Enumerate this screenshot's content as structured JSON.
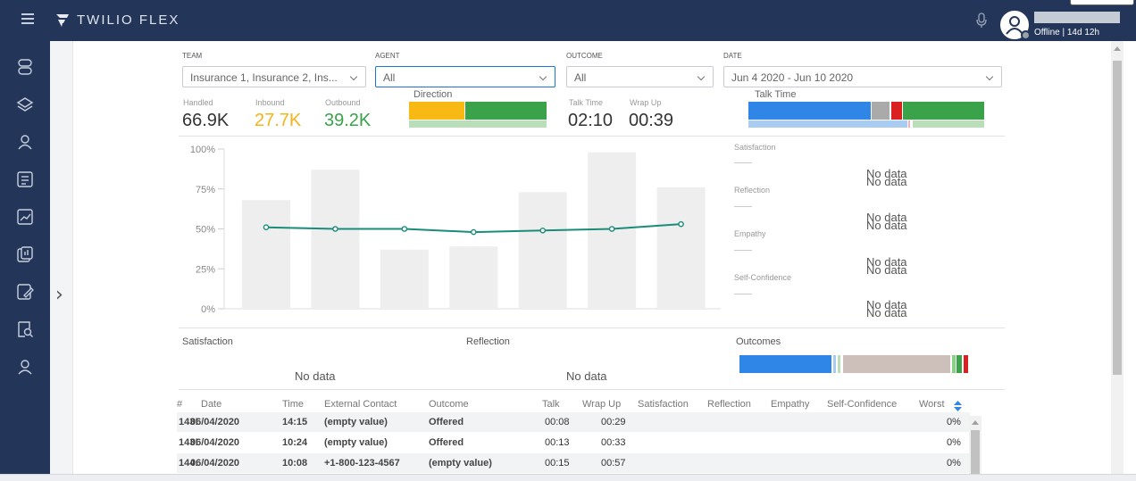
{
  "header": {
    "brand": "TWILIO FLEX",
    "user_status": "Offline | 14d 12h"
  },
  "filters": {
    "team": {
      "label": "TEAM",
      "value": "Insurance 1, Insurance 2, Ins..."
    },
    "agent": {
      "label": "AGENT",
      "value": "All"
    },
    "outcome": {
      "label": "OUTCOME",
      "value": "All"
    },
    "date": {
      "label": "DATE",
      "value": "Jun 4 2020 - Jun 10 2020"
    }
  },
  "kpis": {
    "handled": {
      "label": "Handled",
      "value": "66.9K"
    },
    "inbound": {
      "label": "Inbound",
      "value": "27.7K"
    },
    "outbound": {
      "label": "Outbound",
      "value": "39.2K"
    },
    "direction_title": "Direction",
    "talk_time": {
      "label": "Talk Time",
      "value": "02:10"
    },
    "wrap_up": {
      "label": "Wrap Up",
      "value": "00:39"
    },
    "talk_time_title": "Talk Time"
  },
  "colors": {
    "inbound": "#f9b915",
    "outbound": "#3aa34a",
    "blue": "#2f86e6",
    "red": "#d92121",
    "grey": "#aaaaaa",
    "light_green": "#b9dfb8",
    "light_blue": "#a9cdf2",
    "beige": "#cdbfb9",
    "line": "#1a8c7a"
  },
  "chart_data": {
    "type": "bar",
    "yticks": [
      "100%",
      "75%",
      "50%",
      "25%",
      "0%"
    ],
    "ylim": [
      0,
      100
    ],
    "bars": [
      68,
      87,
      37,
      39,
      73,
      98,
      76
    ],
    "line": [
      51,
      50,
      50,
      48,
      49,
      50,
      53
    ]
  },
  "metrics": {
    "satisfaction": {
      "label": "Satisfaction",
      "nodata": "No data"
    },
    "reflection": {
      "label": "Reflection",
      "nodata": "No data"
    },
    "empathy": {
      "label": "Empathy",
      "nodata": "No data"
    },
    "self_confidence": {
      "label": "Self-Confidence",
      "nodata": "No data"
    }
  },
  "sections": {
    "satisfaction": {
      "title": "Satisfaction",
      "nodata": "No data"
    },
    "reflection": {
      "title": "Reflection",
      "nodata": "No data"
    },
    "outcomes": {
      "title": "Outcomes"
    }
  },
  "table": {
    "columns": [
      "#",
      "Date",
      "Time",
      "External Contact",
      "Outcome",
      "Talk",
      "Wrap Up",
      "Satisfaction",
      "Reflection",
      "Empathy",
      "Self-Confidence",
      "Worst"
    ],
    "rows": [
      {
        "num": "143!",
        "date": "06/04/2020",
        "time": "14:15",
        "contact": "(empty value)",
        "outcome": "Offered",
        "talk": "00:08",
        "wrap": "00:29",
        "worst": "0%"
      },
      {
        "num": "143!",
        "date": "06/04/2020",
        "time": "10:24",
        "contact": "(empty value)",
        "outcome": "Offered",
        "talk": "00:13",
        "wrap": "00:33",
        "worst": "0%"
      },
      {
        "num": "144:",
        "date": "06/04/2020",
        "time": "10:08",
        "contact": "+1-800-123-4567",
        "outcome": "(empty value)",
        "talk": "00:15",
        "wrap": "00:57",
        "worst": "0%"
      }
    ]
  }
}
